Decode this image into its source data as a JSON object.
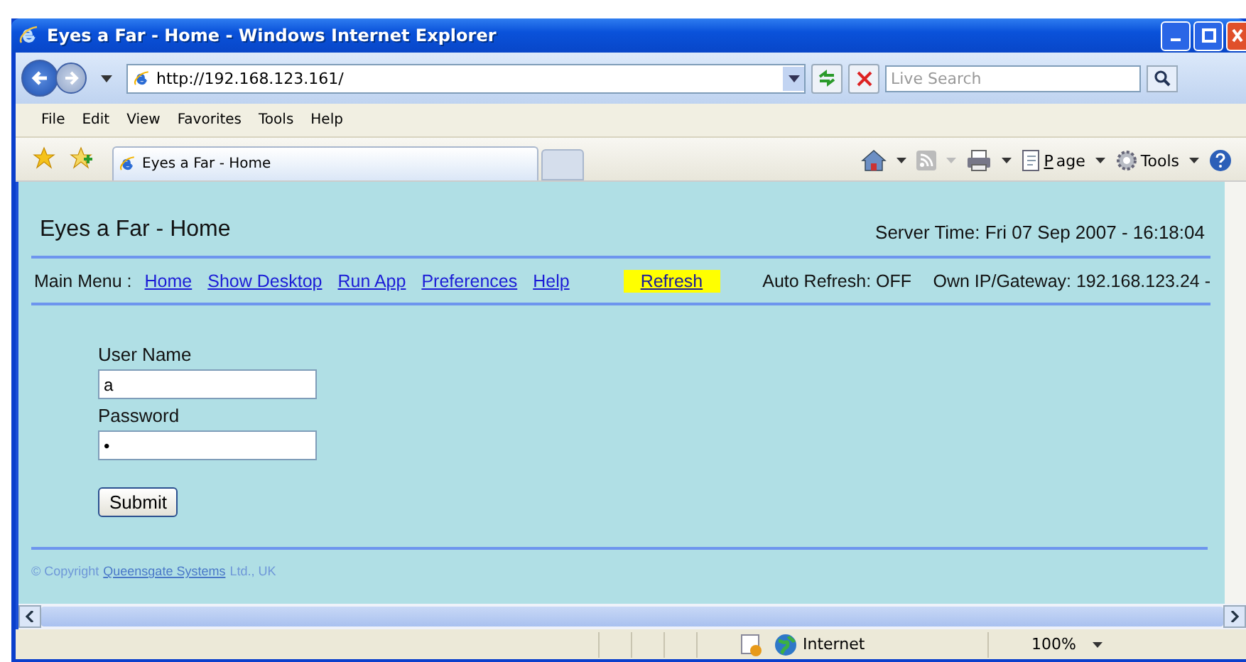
{
  "window": {
    "title": "Eyes a Far - Home - Windows Internet Explorer"
  },
  "address_bar": {
    "url": "http://192.168.123.161/",
    "search_placeholder": "Live Search"
  },
  "menu_bar": [
    "File",
    "Edit",
    "View",
    "Favorites",
    "Tools",
    "Help"
  ],
  "tabs": [
    {
      "label": "Eyes a Far - Home",
      "selected": true
    }
  ],
  "command_bar": {
    "page": "Page",
    "tools": "Tools"
  },
  "page": {
    "title": "Eyes a Far - Home",
    "server_time": "Server Time: Fri 07 Sep 2007 - 16:18:04",
    "menu_label": "Main Menu :",
    "links": [
      {
        "label": "Home",
        "highlighted": false
      },
      {
        "label": "Show Desktop",
        "highlighted": false
      },
      {
        "label": "Run App",
        "highlighted": false
      },
      {
        "label": "Preferences",
        "highlighted": false
      },
      {
        "label": "Help",
        "highlighted": false
      },
      {
        "label": "Refresh",
        "highlighted": true
      }
    ],
    "auto_refresh": "Auto Refresh: OFF",
    "own_ip": "Own IP/Gateway: 192.168.123.24 -",
    "fields": [
      {
        "label": "User Name",
        "value": "a"
      },
      {
        "label": "Password",
        "value": "•"
      }
    ],
    "submit": "Submit",
    "footer": {
      "copyright": "© Copyright",
      "company_link": "Queensgate Systems",
      "rest": "Ltd., UK"
    }
  },
  "status_bar": {
    "zone": "Internet",
    "zoom": "100%"
  }
}
